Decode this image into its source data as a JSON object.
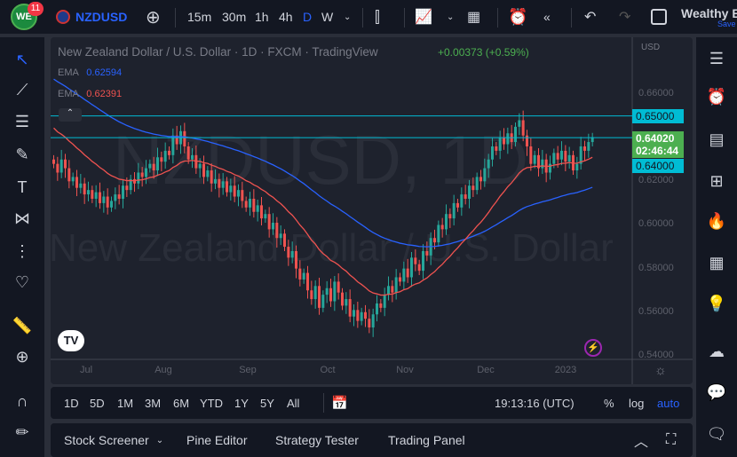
{
  "header": {
    "badge_count": "11",
    "symbol": "NZDUSD",
    "timeframes": [
      "15m",
      "30m",
      "1h",
      "4h",
      "D",
      "W"
    ],
    "active_timeframe": "D",
    "account": "Wealthy E",
    "save": "Save"
  },
  "legend": {
    "title": "New Zealand Dollar / U.S. Dollar · 1D · FXCM · TradingView",
    "change": "+0.00373 (+0.59%)",
    "ema1_label": "EMA",
    "ema1_value": "0.62594",
    "ema2_label": "EMA",
    "ema2_value": "0.62391"
  },
  "watermark": {
    "symbol": "NZDUSD, 1D",
    "name": "New Zealand Dollar / U.S. Dollar"
  },
  "price_axis": {
    "currency": "USD",
    "ticks": [
      "0.66000",
      "0.62000",
      "0.60000",
      "0.58000",
      "0.56000",
      "0.54000"
    ],
    "line1": "0.65000",
    "current": "0.64020",
    "countdown": "02:46:44",
    "line2": "0.64000"
  },
  "time_axis": [
    "Jul",
    "Aug",
    "Sep",
    "Oct",
    "Nov",
    "Dec",
    "2023"
  ],
  "range_bar": {
    "ranges": [
      "1D",
      "5D",
      "1M",
      "3M",
      "6M",
      "YTD",
      "1Y",
      "5Y",
      "All"
    ],
    "time": "19:13:16 (UTC)",
    "percent": "%",
    "log": "log",
    "auto": "auto"
  },
  "panel": {
    "tabs": [
      "Stock Screener",
      "Pine Editor",
      "Strategy Tester",
      "Trading Panel"
    ]
  },
  "colors": {
    "up": "#26a69a",
    "down": "#ef5350",
    "ema_fast": "#ef5350",
    "ema_slow": "#2962ff",
    "accent": "#2962ff",
    "level": "#00bcd4",
    "current": "#4caf50"
  },
  "chart_data": {
    "type": "candlestick",
    "symbol": "NZDUSD",
    "ylim": [
      0.54,
      0.66
    ],
    "levels": [
      0.65,
      0.64
    ],
    "closes": [
      0.628,
      0.624,
      0.63,
      0.626,
      0.62,
      0.622,
      0.617,
      0.619,
      0.614,
      0.616,
      0.612,
      0.615,
      0.61,
      0.613,
      0.608,
      0.611,
      0.614,
      0.612,
      0.618,
      0.616,
      0.621,
      0.619,
      0.624,
      0.622,
      0.626,
      0.628,
      0.625,
      0.631,
      0.629,
      0.634,
      0.632,
      0.641,
      0.637,
      0.643,
      0.636,
      0.63,
      0.632,
      0.626,
      0.628,
      0.622,
      0.625,
      0.619,
      0.621,
      0.617,
      0.62,
      0.615,
      0.618,
      0.613,
      0.616,
      0.611,
      0.608,
      0.612,
      0.606,
      0.609,
      0.603,
      0.605,
      0.598,
      0.601,
      0.594,
      0.596,
      0.59,
      0.585,
      0.588,
      0.58,
      0.575,
      0.578,
      0.57,
      0.566,
      0.572,
      0.562,
      0.568,
      0.571,
      0.565,
      0.574,
      0.569,
      0.563,
      0.566,
      0.558,
      0.561,
      0.556,
      0.56,
      0.557,
      0.553,
      0.559,
      0.564,
      0.562,
      0.568,
      0.572,
      0.569,
      0.576,
      0.574,
      0.58,
      0.576,
      0.585,
      0.582,
      0.579,
      0.588,
      0.586,
      0.594,
      0.592,
      0.6,
      0.598,
      0.605,
      0.603,
      0.61,
      0.608,
      0.614,
      0.612,
      0.618,
      0.616,
      0.622,
      0.62,
      0.626,
      0.63,
      0.636,
      0.634,
      0.64,
      0.637,
      0.642,
      0.638,
      0.645,
      0.648,
      0.641,
      0.636,
      0.628,
      0.632,
      0.626,
      0.63,
      0.624,
      0.628,
      0.633,
      0.63,
      0.634,
      0.629,
      0.632,
      0.625,
      0.628,
      0.636,
      0.634,
      0.638,
      0.6402
    ]
  }
}
